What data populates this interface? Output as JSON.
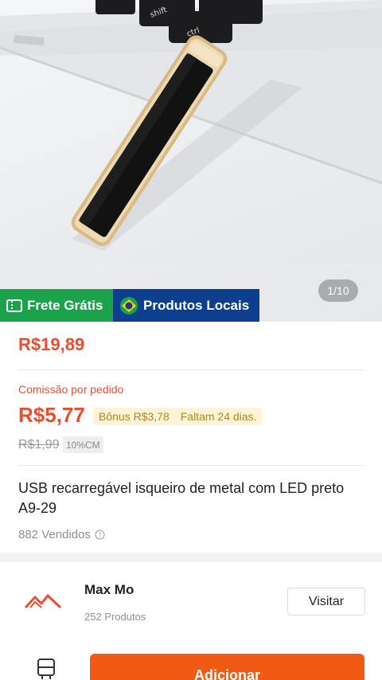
{
  "gallery": {
    "page_counter": "1/10",
    "image": "usb-lighter-product-photo"
  },
  "badges": {
    "frete": {
      "label": "Frete Grátis",
      "color": "#1aa34a",
      "icon": "ticket-icon"
    },
    "local": {
      "label": "Produtos Locais",
      "color": "#0d3f8f",
      "icon": "brazil-flag-icon"
    }
  },
  "price": {
    "current": "R$19,89",
    "commission_label": "Comissão por pedido",
    "commission_value": "R$5,77",
    "bonus": "Bônus R$3,78",
    "days_left": "Faltam 24 dias.",
    "old_price": "R$1,99",
    "cm_tag": "10%CM",
    "accent_color": "#ee4d2d"
  },
  "product": {
    "title": "USB recarregável isqueiro de metal com LED preto A9-29",
    "sold": "882 Vendidos"
  },
  "store": {
    "name": "Max Mo",
    "products": "252 Produtos",
    "visit_label": "Visitar"
  },
  "bottom": {
    "add_label": "Adicionar",
    "add_color": "#f25a13"
  }
}
